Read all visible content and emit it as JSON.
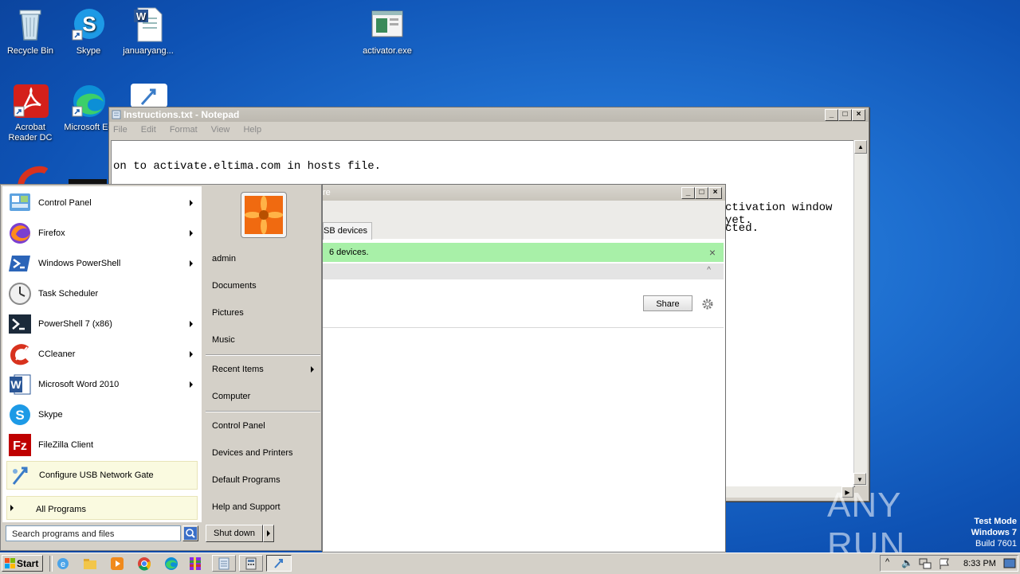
{
  "desktop": {
    "icons": [
      {
        "label": "Recycle Bin"
      },
      {
        "label": "Skype"
      },
      {
        "label": "januaryang..."
      },
      {
        "label": "activator.exe"
      },
      {
        "label": "Acrobat\nReader DC"
      },
      {
        "label": "Microsoft Ed"
      }
    ],
    "watermark": {
      "brand": "ANY RUN",
      "mode_line1": "Test Mode",
      "mode_line2": "Windows 7",
      "mode_line3": "Build 7601"
    }
  },
  "notepad": {
    "title": "Instructions.txt - Notepad",
    "menu": [
      "File",
      "Edit",
      "Format",
      "View",
      "Help"
    ],
    "lines": [
      "on to activate.eltima.com in hosts file.",
      "ctivation window yet.",
      "cted."
    ]
  },
  "usb_window": {
    "title_fragment": "re",
    "tab_label": "SB devices",
    "banner_text": "6 devices.",
    "share_button": "Share"
  },
  "start_menu": {
    "programs": [
      {
        "label": "Control Panel",
        "arrow": true
      },
      {
        "label": "Firefox",
        "arrow": true
      },
      {
        "label": "Windows PowerShell",
        "arrow": true
      },
      {
        "label": "Task Scheduler",
        "arrow": false
      },
      {
        "label": "PowerShell 7 (x86)",
        "arrow": true
      },
      {
        "label": "CCleaner",
        "arrow": true
      },
      {
        "label": "Microsoft Word 2010",
        "arrow": true
      },
      {
        "label": "Skype",
        "arrow": false
      },
      {
        "label": "FileZilla Client",
        "arrow": false
      },
      {
        "label": "Configure USB Network Gate",
        "arrow": false
      }
    ],
    "all_programs": "All Programs",
    "search_placeholder": "Search programs and files",
    "user": "admin",
    "right_items": [
      "Documents",
      "Pictures",
      "Music",
      "Recent Items",
      "Computer",
      "Control Panel",
      "Devices and Printers",
      "Default Programs",
      "Help and Support"
    ],
    "shutdown": "Shut down"
  },
  "taskbar": {
    "start_label": "Start",
    "clock": "8:33 PM"
  },
  "colors": {
    "desktop_blue": "#1e6fd0",
    "highlight_yellow": "#fafae0",
    "banner_green": "#a8f0a8"
  }
}
